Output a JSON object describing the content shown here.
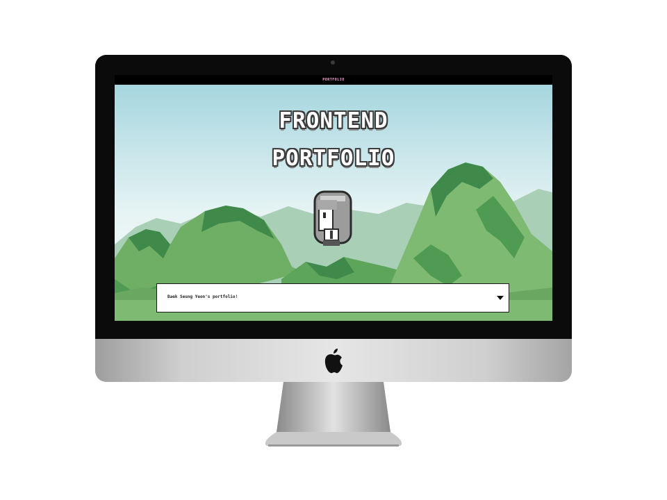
{
  "window": {
    "title": "PORTFOLIO"
  },
  "hero": {
    "line1": "FRONTEND",
    "line2": "PORTFOLIO"
  },
  "dialog": {
    "text": "Baek Seung Yeon's portfolio!"
  },
  "icons": {
    "device_logo": "apple-icon",
    "dialog_next": "triangle-down-icon",
    "avatar": "pixel-character"
  },
  "colors": {
    "sky_top": "#a6d6df",
    "sky_bottom": "#f5fbfb",
    "mountain_dark": "#3f8a4a",
    "mountain_light": "#7fba73",
    "titlebar_text": "#f2a6d3"
  }
}
